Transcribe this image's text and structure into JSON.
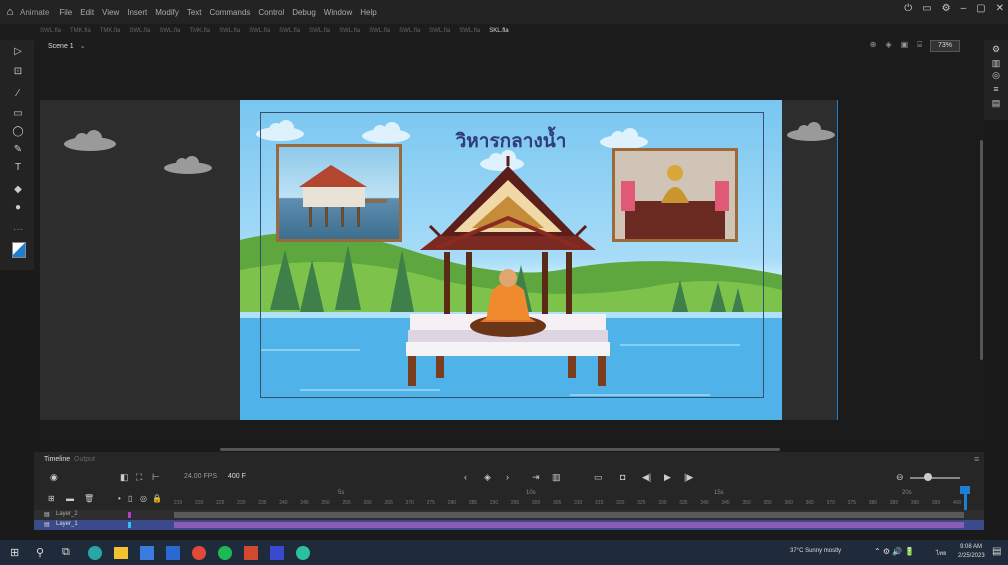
{
  "menubar": {
    "app_name": "Animate",
    "items": [
      "File",
      "Edit",
      "View",
      "Insert",
      "Modify",
      "Text",
      "Commands",
      "Control",
      "Debug",
      "Window",
      "Help"
    ]
  },
  "document_tabs": {
    "tabs": [
      "SWL.fla",
      "TMK.fla",
      "TMK.fla",
      "SWL.fla",
      "SWL.fla",
      "TMK.fla",
      "SWL.fla",
      "SWL.fla",
      "SWL.fla",
      "SWL.fla",
      "SWL.fla",
      "SWL.fla",
      "SWL.fla",
      "SWL.fla",
      "SWL.fla",
      "SWL.fla"
    ],
    "active": "SKL.fla"
  },
  "editbar": {
    "scene_label": "Scene 1",
    "zoom": "73%"
  },
  "stage": {
    "title": "วิหารกลางน้ำ"
  },
  "timeline": {
    "tabs": [
      "Timeline",
      "Output"
    ],
    "fps": "24.00 FPS",
    "frame_label": "400 F",
    "layers": [
      "Layer_2",
      "Layer_1"
    ],
    "ruler_numbers": [
      "5s",
      "10s",
      "15s",
      "20s"
    ],
    "frame_ticks": [
      "215",
      "220",
      "225",
      "230",
      "235",
      "240",
      "245",
      "250",
      "255",
      "260",
      "265",
      "270",
      "275",
      "280",
      "285",
      "290",
      "295",
      "300",
      "305",
      "310",
      "315",
      "320",
      "325",
      "330",
      "335",
      "340",
      "345",
      "350",
      "355",
      "360",
      "365",
      "370",
      "375",
      "380",
      "385",
      "390",
      "395",
      "400"
    ]
  },
  "taskbar": {
    "weather": "37°C Sunny mostly",
    "language": "ไทย",
    "time": "9:08 AM",
    "date": "2/25/2023"
  },
  "colors": {
    "accent": "#1e7fd0",
    "sky_top": "#78c6f0",
    "water": "#4fb3ea",
    "title_text": "#2f3b7a"
  }
}
